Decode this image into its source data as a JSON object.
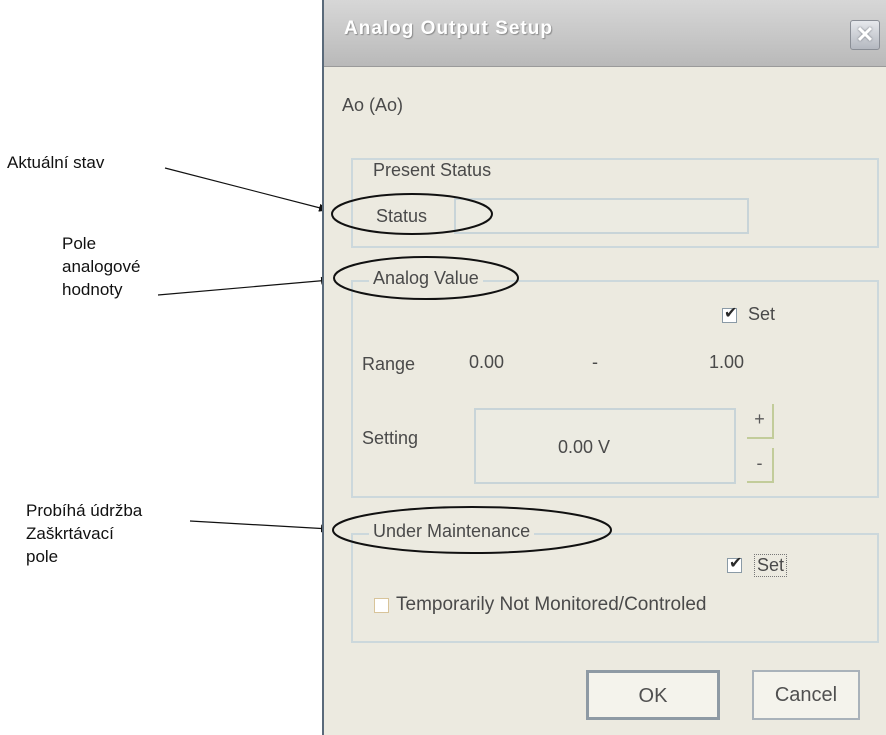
{
  "annotations": [
    {
      "lines": [
        "Aktuální stav"
      ]
    },
    {
      "lines": [
        "Pole",
        "analogové",
        "hodnoty"
      ]
    },
    {
      "lines": [
        "Probíhá údržba",
        "Zaškrtávací",
        "pole"
      ]
    }
  ],
  "dialog": {
    "title": "Analog Output Setup",
    "close_label": "✕",
    "object_name": "Ao  (Ao)",
    "present_status": {
      "group_label": "Present Status",
      "status_label": "Status",
      "status_value": ""
    },
    "analog_value": {
      "group_label": "Analog Value",
      "set_label": "Set",
      "set_checked": true,
      "range_label": "Range",
      "range_min": "0.00",
      "range_separator": "-",
      "range_max": "1.00",
      "setting_label": "Setting",
      "setting_value": "0.00 V",
      "increment_label": "+",
      "decrement_label": "-"
    },
    "under_maintenance": {
      "group_label": "Under Maintenance",
      "set_label": "Set",
      "set_checked": true,
      "temp_label": "Temporarily Not Monitored/Controled",
      "temp_checked": false
    },
    "ok_label": "OK",
    "cancel_label": "Cancel"
  },
  "colors": {
    "annotation_ink": "#111111",
    "dialog_bg": "#eceae0",
    "groove": "#ccd8dc"
  }
}
